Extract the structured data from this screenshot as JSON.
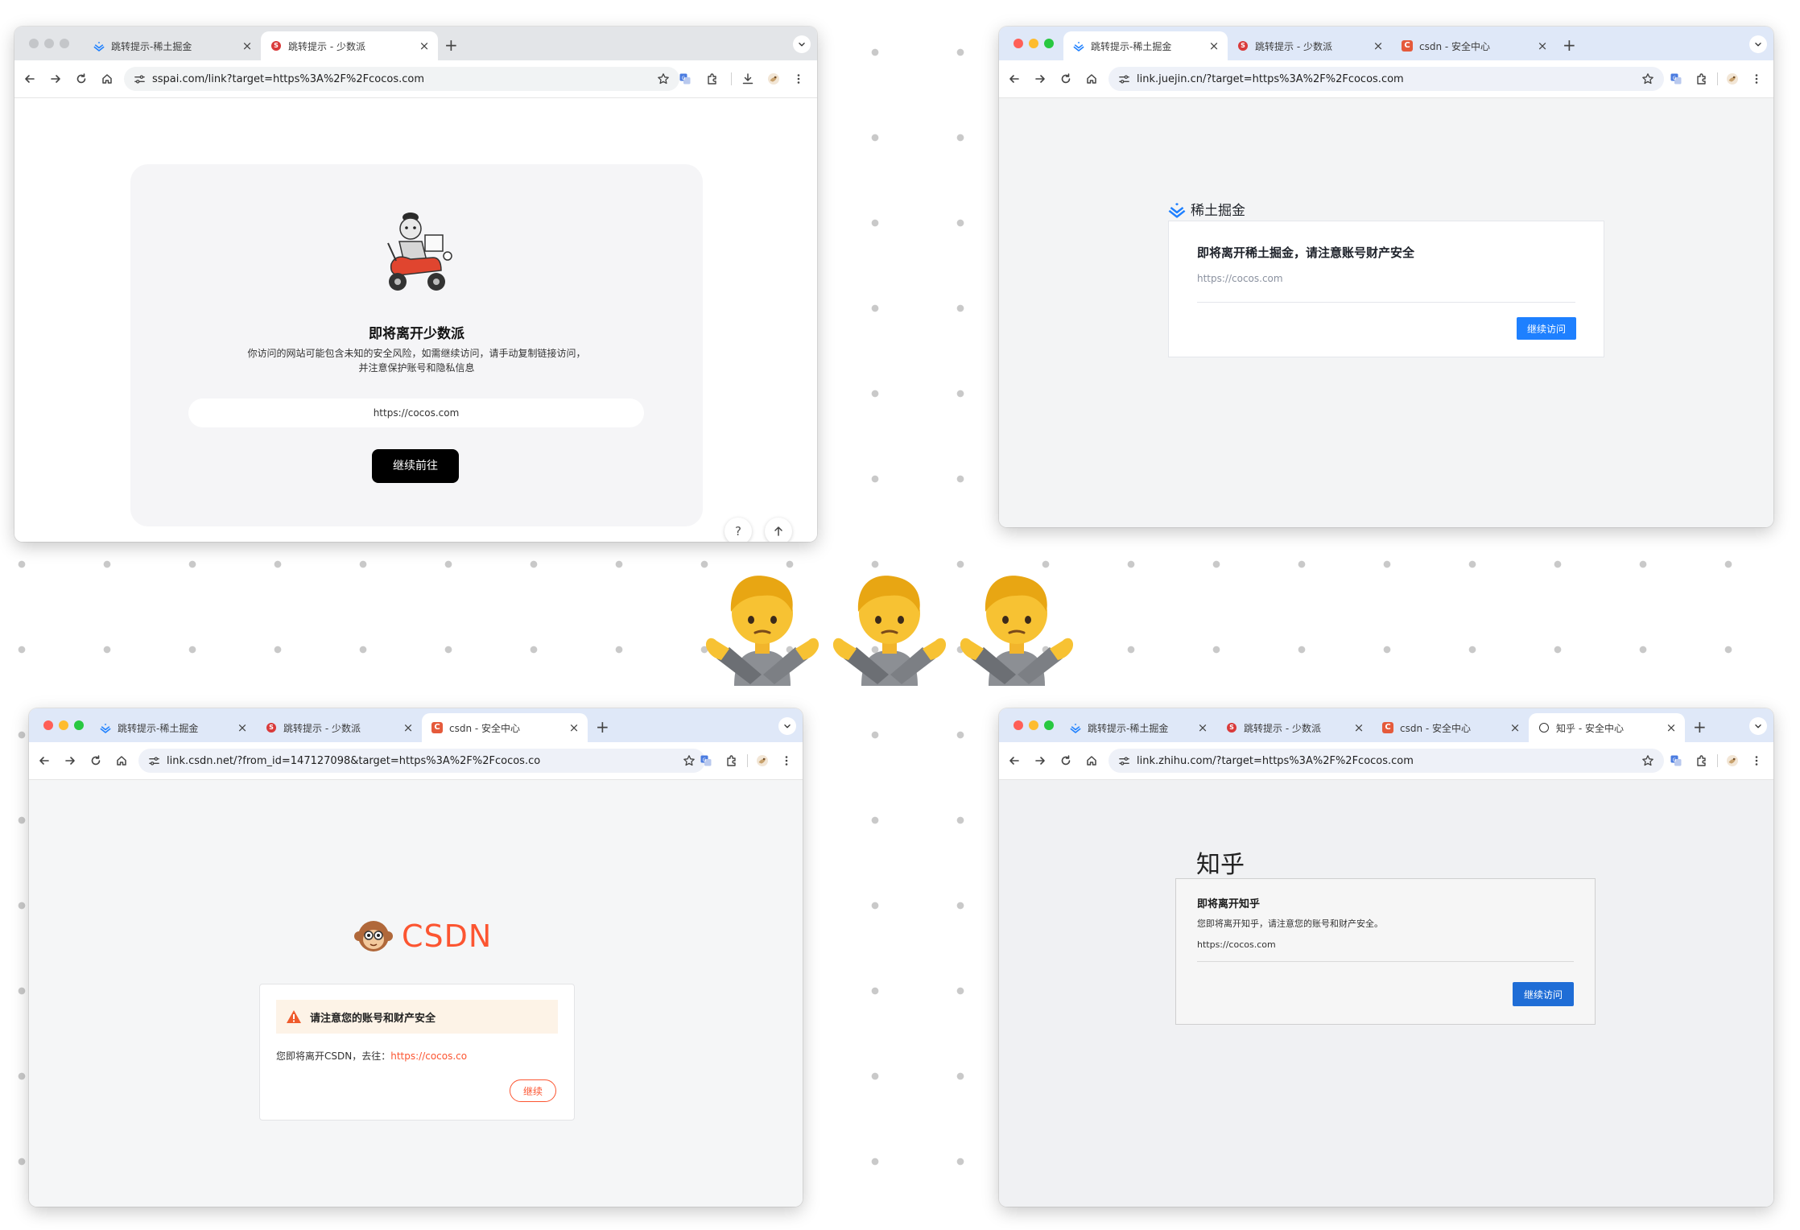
{
  "tabs": {
    "juejin": "跳转提示-稀土掘金",
    "sspai": "跳转提示 - 少数派",
    "csdn": "csdn - 安全中心",
    "zhihu": "知乎 - 安全中心"
  },
  "sspai": {
    "url": "sspai.com/link?target=https%3A%2F%2Fcocos.com",
    "heading": "即将离开少数派",
    "desc_line1": "你访问的网站可能包含未知的安全风险，如需继续访问，请手动复制链接访问，",
    "desc_line2": "并注意保护账号和隐私信息",
    "target": "https://cocos.com",
    "continue": "继续前往",
    "help": "?"
  },
  "juejin": {
    "url": "link.juejin.cn/?target=https%3A%2F%2Fcocos.com",
    "logo": "稀土掘金",
    "heading": "即将离开稀土掘金，请注意账号财产安全",
    "target": "https://cocos.com",
    "continue": "继续访问"
  },
  "csdn": {
    "url": "link.csdn.net/?from_id=147127098&target=https%3A%2F%2Fcocos.co",
    "logo": "CSDN",
    "warning": "请注意您的账号和财产安全",
    "leaving": "您即将离开CSDN，去往：",
    "link": "https://cocos.co",
    "continue": "继续"
  },
  "zhihu": {
    "url": "link.zhihu.com/?target=https%3A%2F%2Fcocos.com",
    "logo": "知乎",
    "heading": "即将离开知乎",
    "desc": "您即将离开知乎，请注意您的账号和财产安全。",
    "target": "https://cocos.com",
    "continue": "继续访问"
  },
  "center_emoji": "no-gesture-person-emoji",
  "colors": {
    "close_light": "#ff5f57",
    "min_light": "#febc2e",
    "max_light": "#28c840",
    "juejin_blue": "#1e80ff",
    "csdn_orange": "#fc5531",
    "zhihu_blue": "#1f6dd6"
  }
}
